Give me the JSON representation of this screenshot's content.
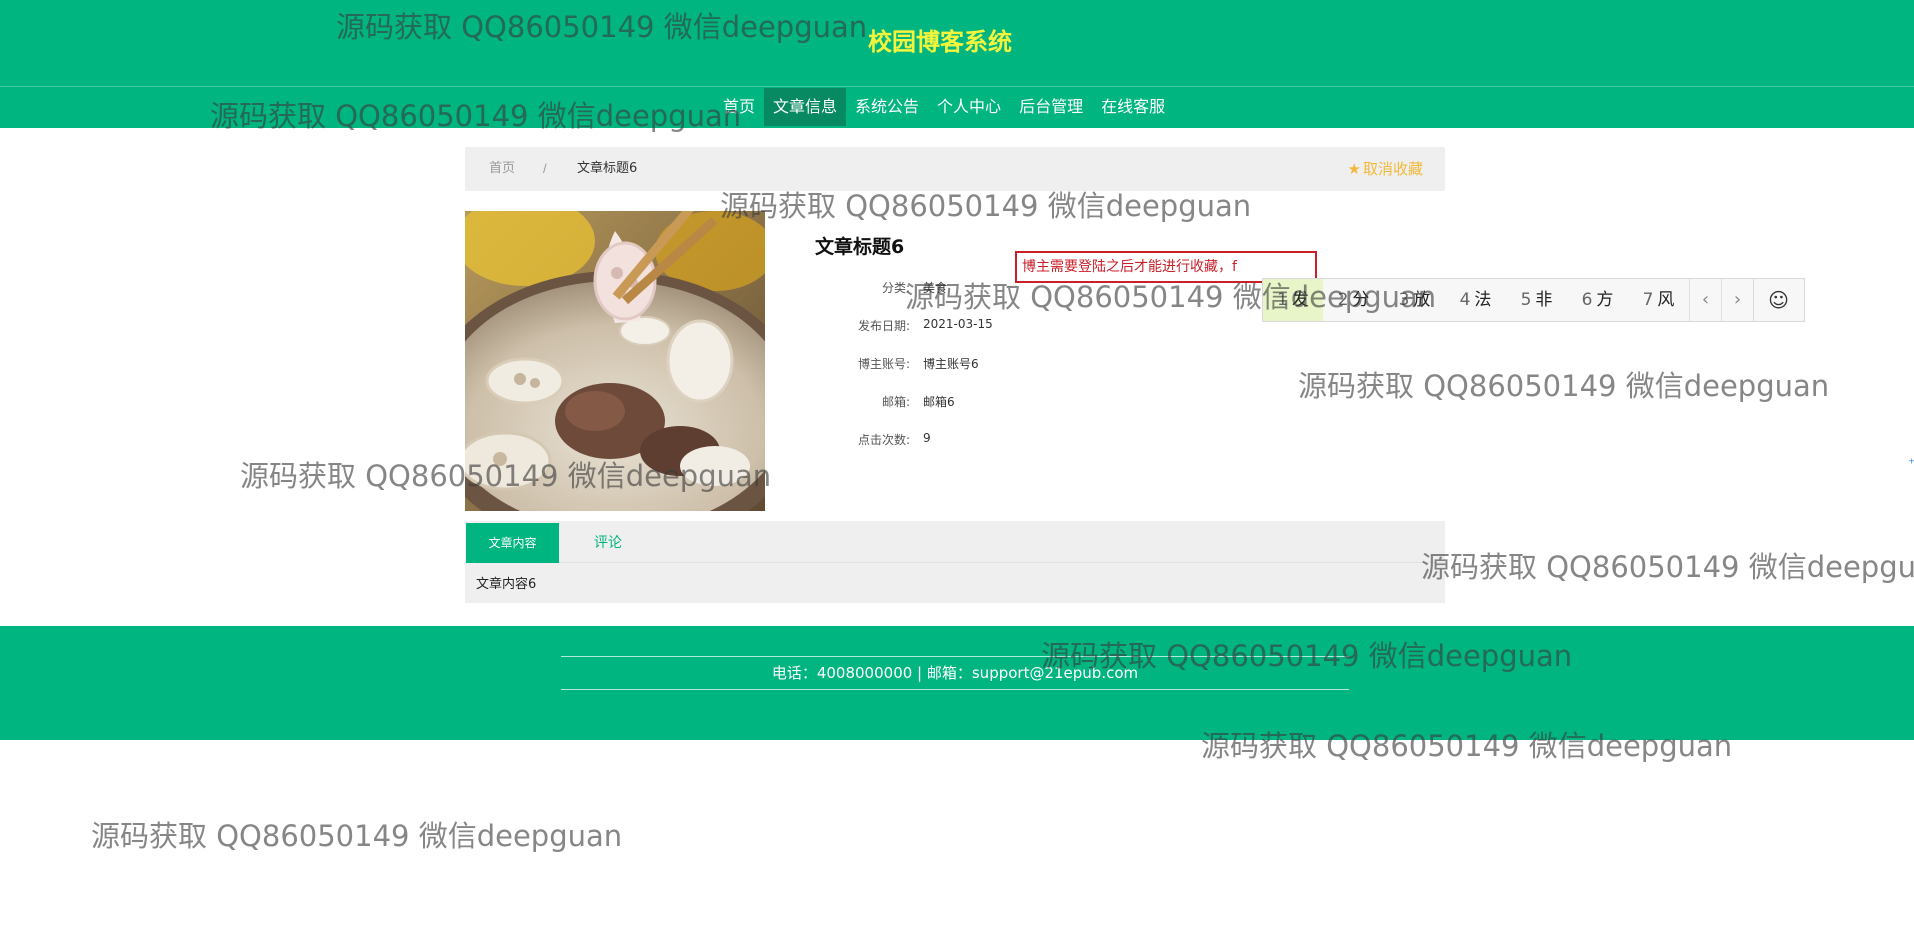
{
  "header": {
    "site_title": "校园博客系统",
    "nav": [
      {
        "label": "首页",
        "active": false
      },
      {
        "label": "文章信息",
        "active": true
      },
      {
        "label": "系统公告",
        "active": false
      },
      {
        "label": "个人中心",
        "active": false
      },
      {
        "label": "后台管理",
        "active": false
      },
      {
        "label": "在线客服",
        "active": false
      }
    ]
  },
  "breadcrumb": {
    "home": "首页",
    "separator": "/",
    "current": "文章标题6",
    "unfavorite_label": "取消收藏",
    "unfavorite_icon": "star-icon"
  },
  "article": {
    "title": "文章标题6",
    "fields": [
      {
        "label": "分类:",
        "value": "美食"
      },
      {
        "label": "发布日期:",
        "value": "2021-03-15"
      },
      {
        "label": "博主账号:",
        "value": "博主账号6"
      },
      {
        "label": "邮箱:",
        "value": "邮箱6"
      },
      {
        "label": "点击次数:",
        "value": "9"
      }
    ]
  },
  "login_message": "博主需要登陆之后才能进行收藏，f",
  "ime": {
    "candidates": [
      {
        "num": "1",
        "text": "发",
        "selected": true
      },
      {
        "num": "2",
        "text": "分",
        "selected": false
      },
      {
        "num": "3",
        "text": "放",
        "selected": false
      },
      {
        "num": "4",
        "text": "法",
        "selected": false
      },
      {
        "num": "5",
        "text": "非",
        "selected": false
      },
      {
        "num": "6",
        "text": "方",
        "selected": false
      },
      {
        "num": "7",
        "text": "风",
        "selected": false
      }
    ],
    "prev": "‹",
    "next": "›",
    "emoji": "☺"
  },
  "tabs": {
    "content_tab": "文章内容",
    "comments_tab": "评论",
    "content_text": "文章内容6"
  },
  "footer": {
    "contact": "电话：4008000000 | 邮箱：support@21epub.com"
  },
  "watermark_text": "源码获取 QQ86050149 微信deepguan",
  "colors": {
    "primary_green": "#00b580",
    "nav_active": "#078a62",
    "title_yellow": "#f3f53c",
    "favorite_gold": "#f0b93a",
    "error_red": "#c9202a"
  }
}
